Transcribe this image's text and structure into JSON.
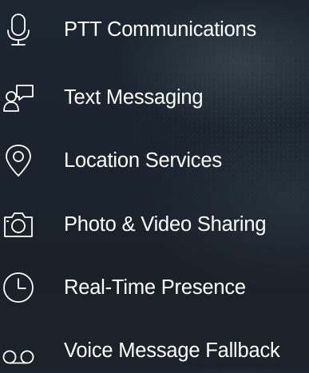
{
  "features": {
    "items": [
      {
        "label": "PTT Communications",
        "icon": "microphone-icon"
      },
      {
        "label": "Text Messaging",
        "icon": "person-chat-icon"
      },
      {
        "label": "Location Services",
        "icon": "location-pin-icon"
      },
      {
        "label": "Photo & Video Sharing",
        "icon": "camera-icon"
      },
      {
        "label": "Real-Time Presence",
        "icon": "clock-icon"
      },
      {
        "label": "Voice Message Fallback",
        "icon": "voicemail-icon"
      }
    ]
  },
  "colors": {
    "text": "#ffffff",
    "background": "#1c242d"
  }
}
